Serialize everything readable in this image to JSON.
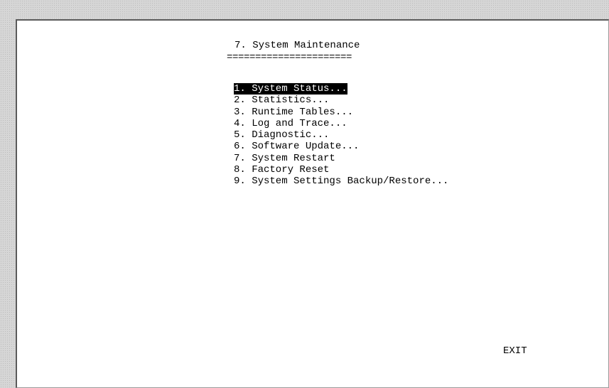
{
  "menu": {
    "title": "7. System Maintenance",
    "rule": "======================",
    "items": [
      {
        "label": "1. System Status...",
        "selected": true
      },
      {
        "label": "2. Statistics...",
        "selected": false
      },
      {
        "label": "3. Runtime Tables...",
        "selected": false
      },
      {
        "label": "4. Log and Trace...",
        "selected": false
      },
      {
        "label": "5. Diagnostic...",
        "selected": false
      },
      {
        "label": "6. Software Update...",
        "selected": false
      },
      {
        "label": "7. System Restart",
        "selected": false
      },
      {
        "label": "8. Factory Reset",
        "selected": false
      },
      {
        "label": "9. System Settings Backup/Restore...",
        "selected": false
      }
    ],
    "exit_label": "EXIT"
  }
}
